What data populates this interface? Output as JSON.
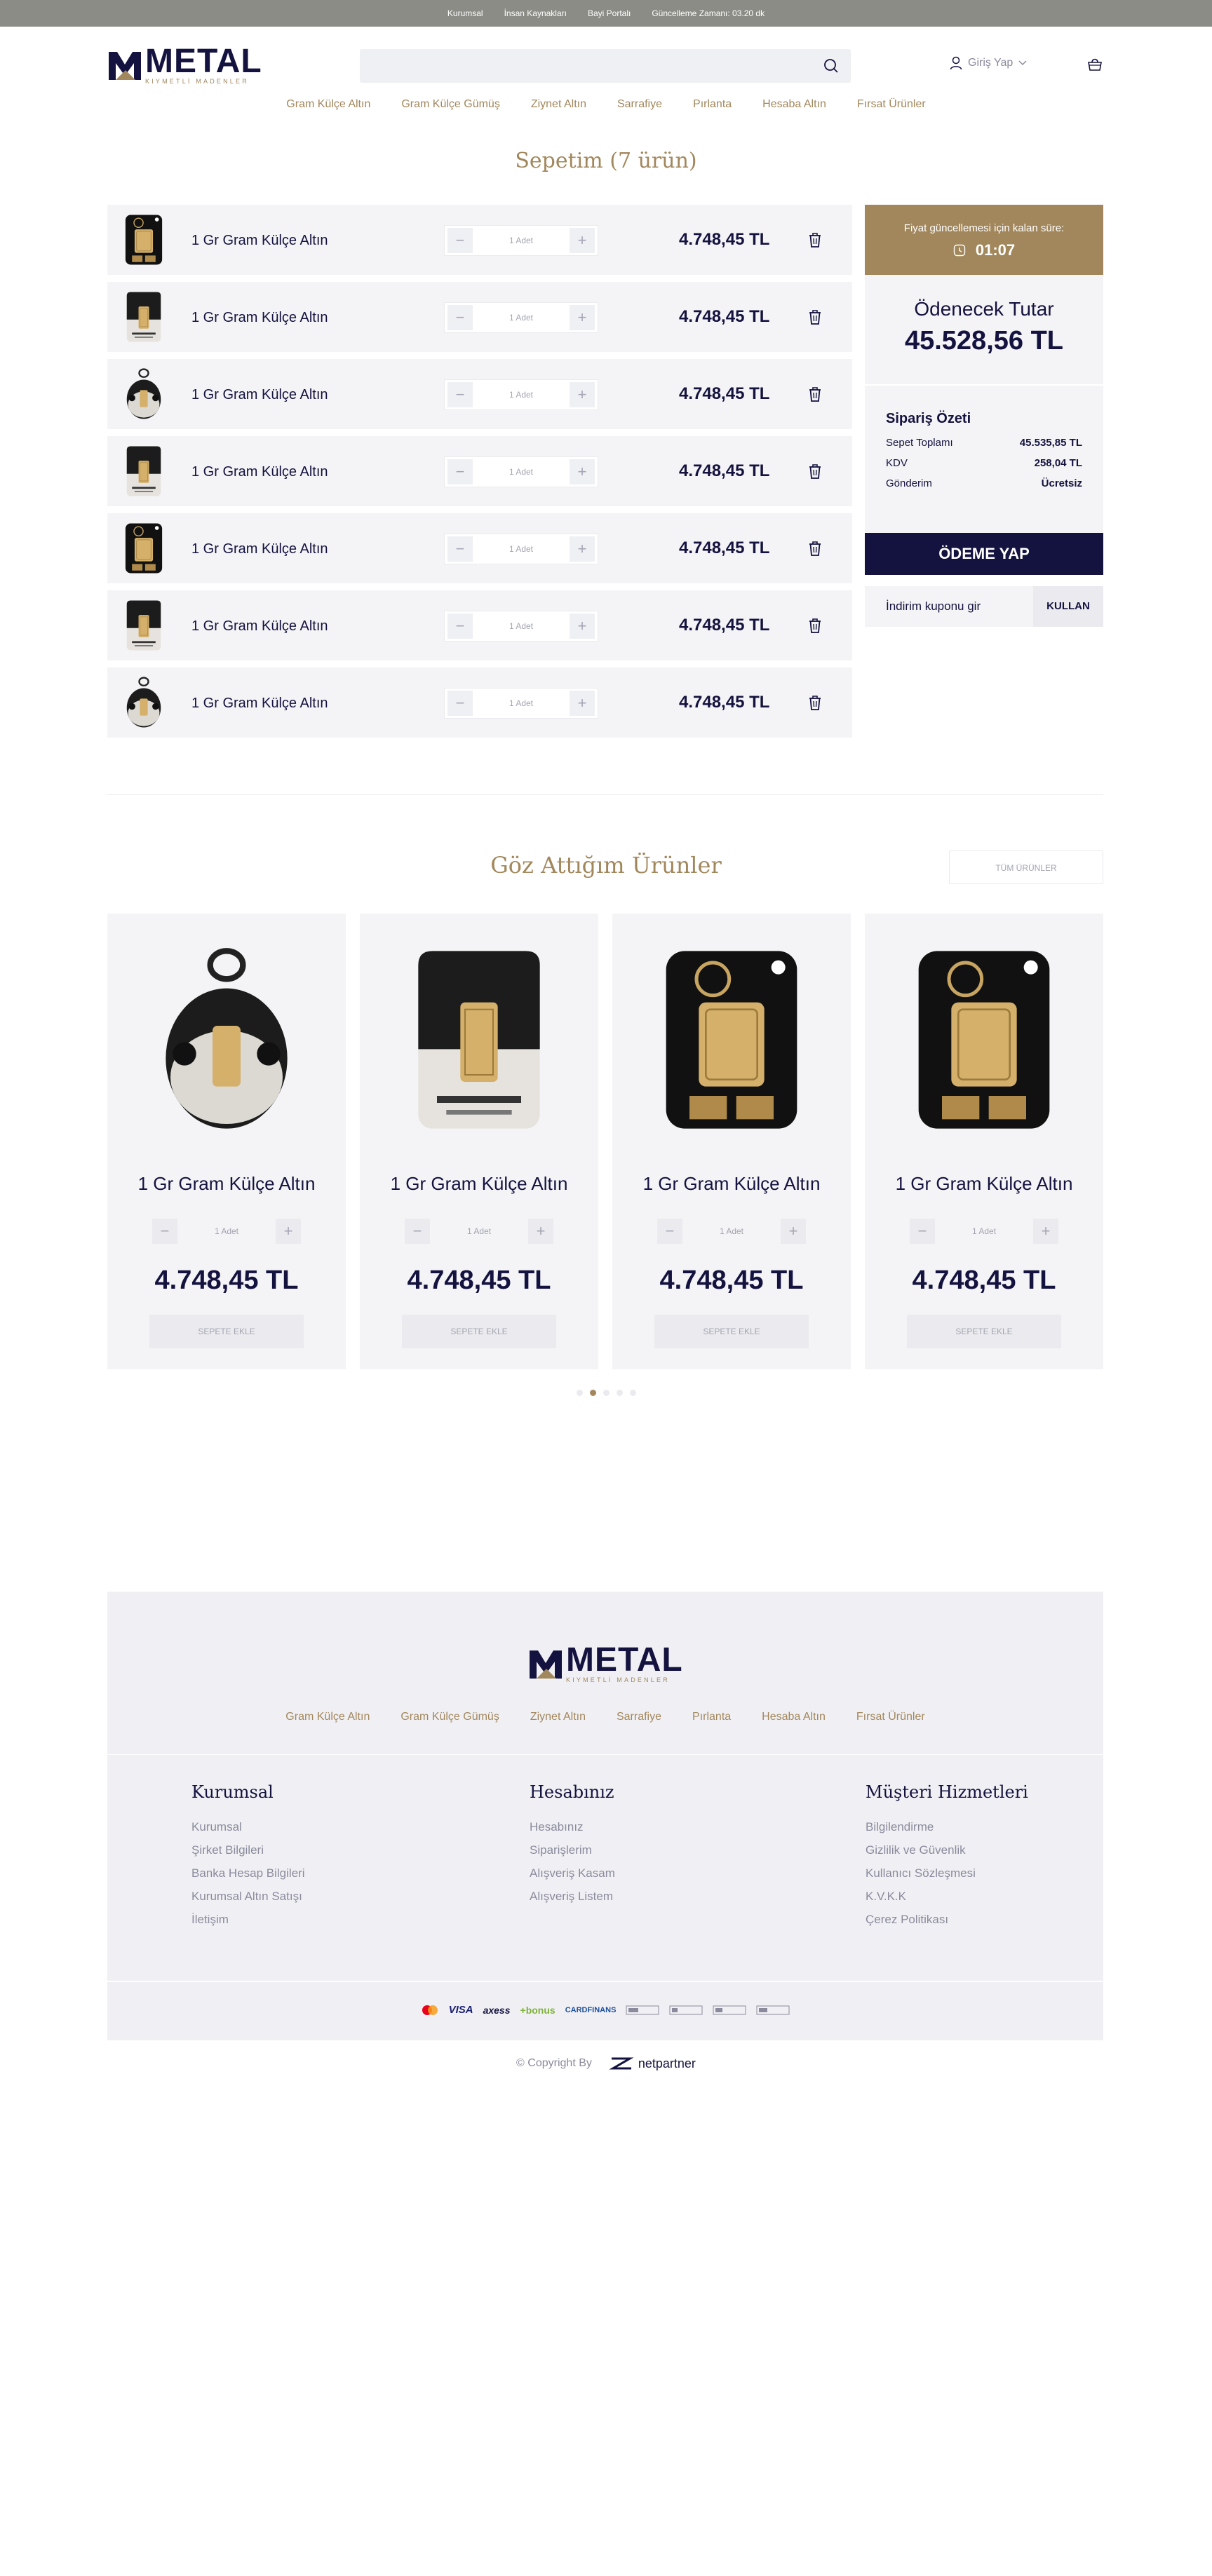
{
  "topbar": {
    "links": [
      "Kurumsal",
      "İnsan Kaynakları",
      "Bayi Portalı"
    ],
    "update_time": "Güncelleme Zamanı: 03.20 dk"
  },
  "logo": {
    "word": "METAL",
    "sub": "KIYMETLİ MADENLER"
  },
  "search": {
    "placeholder": ""
  },
  "header": {
    "login_label": "Giriş Yap"
  },
  "nav": [
    "Gram Külçe Altın",
    "Gram Külçe Gümüş",
    "Ziynet Altın",
    "Sarrafiye",
    "Pırlanta",
    "Hesaba Altın",
    "Fırsat Ürünler"
  ],
  "cart": {
    "title": "Sepetim (7 ürün)",
    "items": [
      {
        "name": "1 Gr Gram Külçe Altın",
        "qty": "1 Adet",
        "price": "4.748,45 TL",
        "image": "ard-gold-bar-black"
      },
      {
        "name": "1 Gr Gram Külçe Altın",
        "qty": "1 Adet",
        "price": "4.748,45 TL",
        "image": "gramaltin-bar-card"
      },
      {
        "name": "1 Gr Gram Külçe Altın",
        "qty": "1 Adet",
        "price": "4.748,45 TL",
        "image": "gramaltin-oval-tag"
      },
      {
        "name": "1 Gr Gram Külçe Altın",
        "qty": "1 Adet",
        "price": "4.748,45 TL",
        "image": "gramaltin-bar-card"
      },
      {
        "name": "1 Gr Gram Külçe Altın",
        "qty": "1 Adet",
        "price": "4.748,45 TL",
        "image": "ard-gold-bar-black"
      },
      {
        "name": "1 Gr Gram Külçe Altın",
        "qty": "1 Adet",
        "price": "4.748,45 TL",
        "image": "gramaltin-bar-card"
      },
      {
        "name": "1 Gr Gram Külçe Altın",
        "qty": "1 Adet",
        "price": "4.748,45 TL",
        "image": "gramaltin-oval-tag"
      }
    ]
  },
  "summary": {
    "timer_label": "Fiyat güncellemesi için kalan süre:",
    "timer_value": "01:07",
    "total_label": "Ödenecek Tutar",
    "total_value": "45.528,56 TL",
    "order_title": "Sipariş Özeti",
    "lines": [
      {
        "label": "Sepet Toplamı",
        "value": "45.535,85 TL"
      },
      {
        "label": "KDV",
        "value": "258,04 TL"
      },
      {
        "label": "Gönderim",
        "value": "Ücretsiz"
      }
    ],
    "pay_label": "ÖDEME YAP",
    "coupon_placeholder": "İndirim kuponu gir",
    "coupon_button": "KULLAN"
  },
  "favorites": {
    "title": "Göz Attığım Ürünler",
    "all_button": "TÜM ÜRÜNLER",
    "products": [
      {
        "name": "1 Gr Gram Külçe Altın",
        "qty": "1 Adet",
        "price": "4.748,45 TL",
        "add_label": "SEPETE EKLE",
        "image": "gramaltin-oval-tag"
      },
      {
        "name": "1 Gr Gram Külçe Altın",
        "qty": "1 Adet",
        "price": "4.748,45 TL",
        "add_label": "SEPETE EKLE",
        "image": "gramaltin-bar-card"
      },
      {
        "name": "1 Gr Gram Külçe Altın",
        "qty": "1 Adet",
        "price": "4.748,45 TL",
        "add_label": "SEPETE EKLE",
        "image": "ard-gold-bar-black"
      },
      {
        "name": "1 Gr Gram Külçe Altın",
        "qty": "1 Adet",
        "price": "4.748,45 TL",
        "add_label": "SEPETE EKLE",
        "image": "ard-gold-bar-black"
      }
    ],
    "slider_pages": 5,
    "slider_active": 2
  },
  "footer": {
    "columns": [
      {
        "title": "Kurumsal",
        "links": [
          "Kurumsal",
          "Şirket Bilgileri",
          "Banka Hesap Bilgileri",
          "Kurumsal Altın Satışı",
          "İletişim"
        ]
      },
      {
        "title": "Hesabınız",
        "links": [
          "Hesabınız",
          "Siparişlerim",
          "Alışveriş Kasam",
          "Alışveriş Listem"
        ]
      },
      {
        "title": "Müşteri Hizmetleri",
        "links": [
          "Bilgilendirme",
          "Gizlilik ve Güvenlik",
          "Kullanıcı Sözleşmesi",
          "K.V.K.K",
          "Çerez Politikası"
        ]
      }
    ],
    "payment_logos": [
      "mastercard-icon",
      "visa-icon",
      "axess-icon",
      "bonus-icon",
      "cardfinans-icon",
      "bank-logo-1-icon",
      "bank-logo-2-icon",
      "bank-logo-3-icon",
      "bank-logo-4-icon"
    ],
    "payment_text": {
      "visa": "VISA",
      "axess": "axess",
      "bonus": "+bonus",
      "cardfinans": "CARDFINANS"
    },
    "copyright": "© Copyright By",
    "partner": "netpartner"
  },
  "colors": {
    "navy": "#14123f",
    "gold": "#a2875c",
    "topbar": "#8b8c86",
    "panel": "#f4f4f6"
  }
}
